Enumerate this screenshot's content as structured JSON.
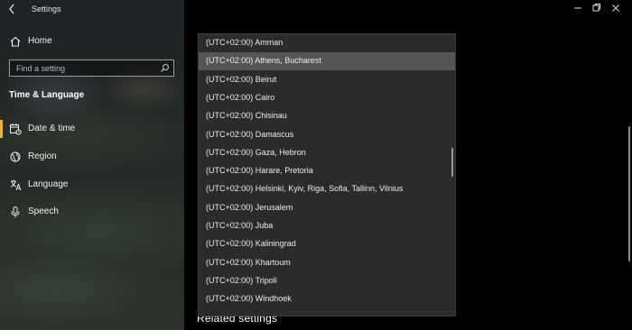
{
  "window": {
    "app_title": "Settings"
  },
  "nav": {
    "home_label": "Home",
    "search": {
      "placeholder": "Find a setting",
      "value": ""
    },
    "section_heading": "Time & Language",
    "items": [
      {
        "label": "Date & time",
        "icon": "calendar-clock-icon",
        "selected": true
      },
      {
        "label": "Region",
        "icon": "globe-icon",
        "selected": false
      },
      {
        "label": "Language",
        "icon": "language-icon",
        "selected": false
      },
      {
        "label": "Speech",
        "icon": "microphone-icon",
        "selected": false
      }
    ]
  },
  "colors": {
    "accent": "#e8b62c",
    "list_background": "#2b2b2b",
    "list_selected": "#555555"
  },
  "timezone_list": {
    "selected_index": 1,
    "items": [
      "(UTC+02:00) Amman",
      "(UTC+02:00) Athens, Bucharest",
      "(UTC+02:00) Beirut",
      "(UTC+02:00) Cairo",
      "(UTC+02:00) Chisinau",
      "(UTC+02:00) Damascus",
      "(UTC+02:00) Gaza, Hebron",
      "(UTC+02:00) Harare, Pretoria",
      "(UTC+02:00) Helsinki, Kyiv, Riga, Sofia, Tallinn, Vilnius",
      "(UTC+02:00) Jerusalem",
      "(UTC+02:00) Juba",
      "(UTC+02:00) Kaliningrad",
      "(UTC+02:00) Khartoum",
      "(UTC+02:00) Tripoli",
      "(UTC+02:00) Windhoek"
    ]
  },
  "main": {
    "related_settings_heading": "Related settings"
  }
}
